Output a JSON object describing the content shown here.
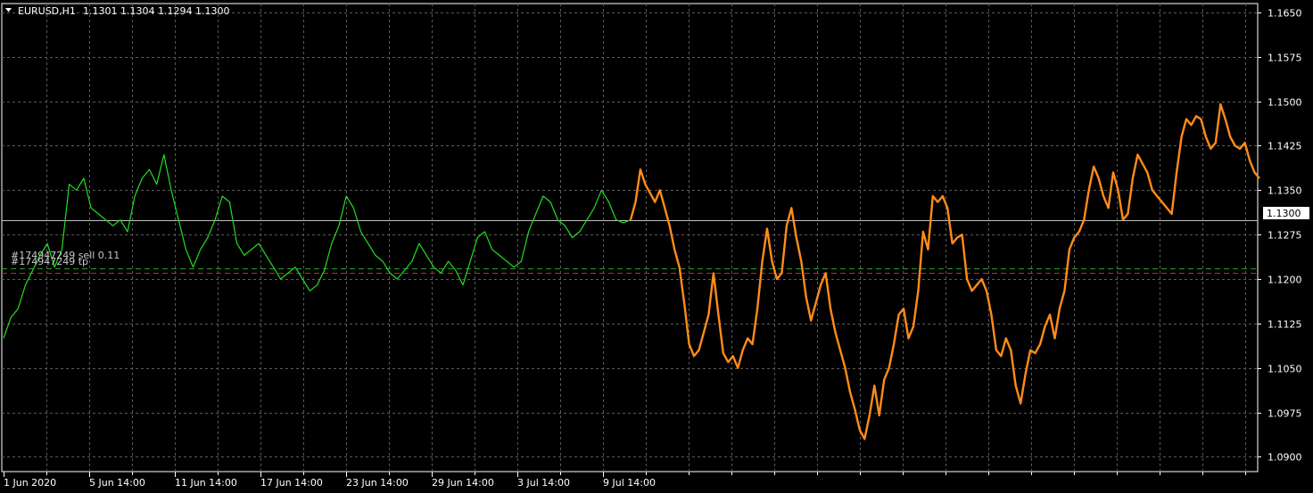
{
  "header": {
    "symbol_tf": "EURUSD,H1",
    "ohlc": "1.1301 1.1304 1.1294 1.1300"
  },
  "colors": {
    "background": "#000000",
    "grid": "#5a5a5a",
    "axis": "#ffffff",
    "history_line": "#22dd22",
    "forecast_line": "#ff8c1a",
    "order_line_green": "#1fa31f",
    "order_line_red": "#d42020",
    "current_price_line": "#c0c0c0"
  },
  "orders": {
    "label_1": "#174947249 sell 0.11",
    "label_2": "#174947249 tp"
  },
  "chart_data": {
    "type": "line",
    "title": "EURUSD,H1",
    "ylim": [
      1.0875,
      1.1665
    ],
    "y_ticks": [
      "1.1650",
      "1.1575",
      "1.1500",
      "1.1425",
      "1.1350",
      "1.1275",
      "1.1200",
      "1.1125",
      "1.1050",
      "1.0975",
      "1.0900"
    ],
    "x_tick_labels": [
      "1 Jun 2020",
      "5 Jun 14:00",
      "11 Jun 14:00",
      "17 Jun 14:00",
      "23 Jun 14:00",
      "29 Jun 14:00",
      "3 Jul 14:00",
      "9 Jul 14:00"
    ],
    "current_price": "1.1300",
    "order_levels": {
      "sell_entry": 1.1218,
      "take_profit": 1.121
    },
    "grid": true,
    "series": [
      {
        "role": "history",
        "y": [
          1.11,
          1.1135,
          1.115,
          1.119,
          1.1215,
          1.124,
          1.126,
          1.122,
          1.125,
          1.136,
          1.135,
          1.137,
          1.132,
          1.131,
          1.13,
          1.129,
          1.13,
          1.128,
          1.134,
          1.137,
          1.1385,
          1.136,
          1.141,
          1.135,
          1.13,
          1.125,
          1.122,
          1.125,
          1.127,
          1.13,
          1.134,
          1.133,
          1.126,
          1.124,
          1.125,
          1.126,
          1.124,
          1.122,
          1.12,
          1.121,
          1.122,
          1.12,
          1.118,
          1.119,
          1.1215,
          1.126,
          1.129,
          1.134,
          1.132,
          1.128,
          1.126,
          1.124,
          1.123,
          1.121,
          1.12,
          1.1215,
          1.123,
          1.126,
          1.124,
          1.122,
          1.121,
          1.123,
          1.1215,
          1.119,
          1.123,
          1.127,
          1.128,
          1.125,
          1.124,
          1.123,
          1.122,
          1.123,
          1.128,
          1.131,
          1.134,
          1.133,
          1.13,
          1.129,
          1.127,
          1.128,
          1.13,
          1.132,
          1.135,
          1.133,
          1.13,
          1.1295,
          1.13
        ]
      },
      {
        "role": "forecast",
        "y": [
          1.13,
          1.133,
          1.1385,
          1.136,
          1.1345,
          1.133,
          1.135,
          1.132,
          1.129,
          1.125,
          1.122,
          1.116,
          1.109,
          1.107,
          1.108,
          1.111,
          1.114,
          1.121,
          1.114,
          1.1075,
          1.106,
          1.107,
          1.105,
          1.108,
          1.11,
          1.109,
          1.115,
          1.123,
          1.1285,
          1.123,
          1.12,
          1.121,
          1.129,
          1.132,
          1.127,
          1.123,
          1.117,
          1.113,
          1.116,
          1.119,
          1.121,
          1.115,
          1.111,
          1.108,
          1.105,
          1.101,
          1.098,
          1.0945,
          1.093,
          1.097,
          1.102,
          1.097,
          1.103,
          1.105,
          1.109,
          1.114,
          1.115,
          1.11,
          1.112,
          1.118,
          1.128,
          1.125,
          1.134,
          1.133,
          1.134,
          1.132,
          1.126,
          1.127,
          1.1275,
          1.12,
          1.118,
          1.119,
          1.12,
          1.118,
          1.114,
          1.108,
          1.107,
          1.11,
          1.108,
          1.102,
          1.099,
          1.104,
          1.108,
          1.1075,
          1.109,
          1.112,
          1.114,
          1.11,
          1.115,
          1.118,
          1.125,
          1.127,
          1.128,
          1.13,
          1.135,
          1.139,
          1.137,
          1.134,
          1.132,
          1.138,
          1.135,
          1.13,
          1.131,
          1.137,
          1.141,
          1.1395,
          1.138,
          1.135,
          1.134,
          1.133,
          1.132,
          1.131,
          1.138,
          1.144,
          1.147,
          1.146,
          1.1475,
          1.147,
          1.144,
          1.142,
          1.143,
          1.1495,
          1.147,
          1.144,
          1.1425,
          1.142,
          1.143,
          1.14,
          1.138,
          1.137
        ]
      }
    ]
  }
}
